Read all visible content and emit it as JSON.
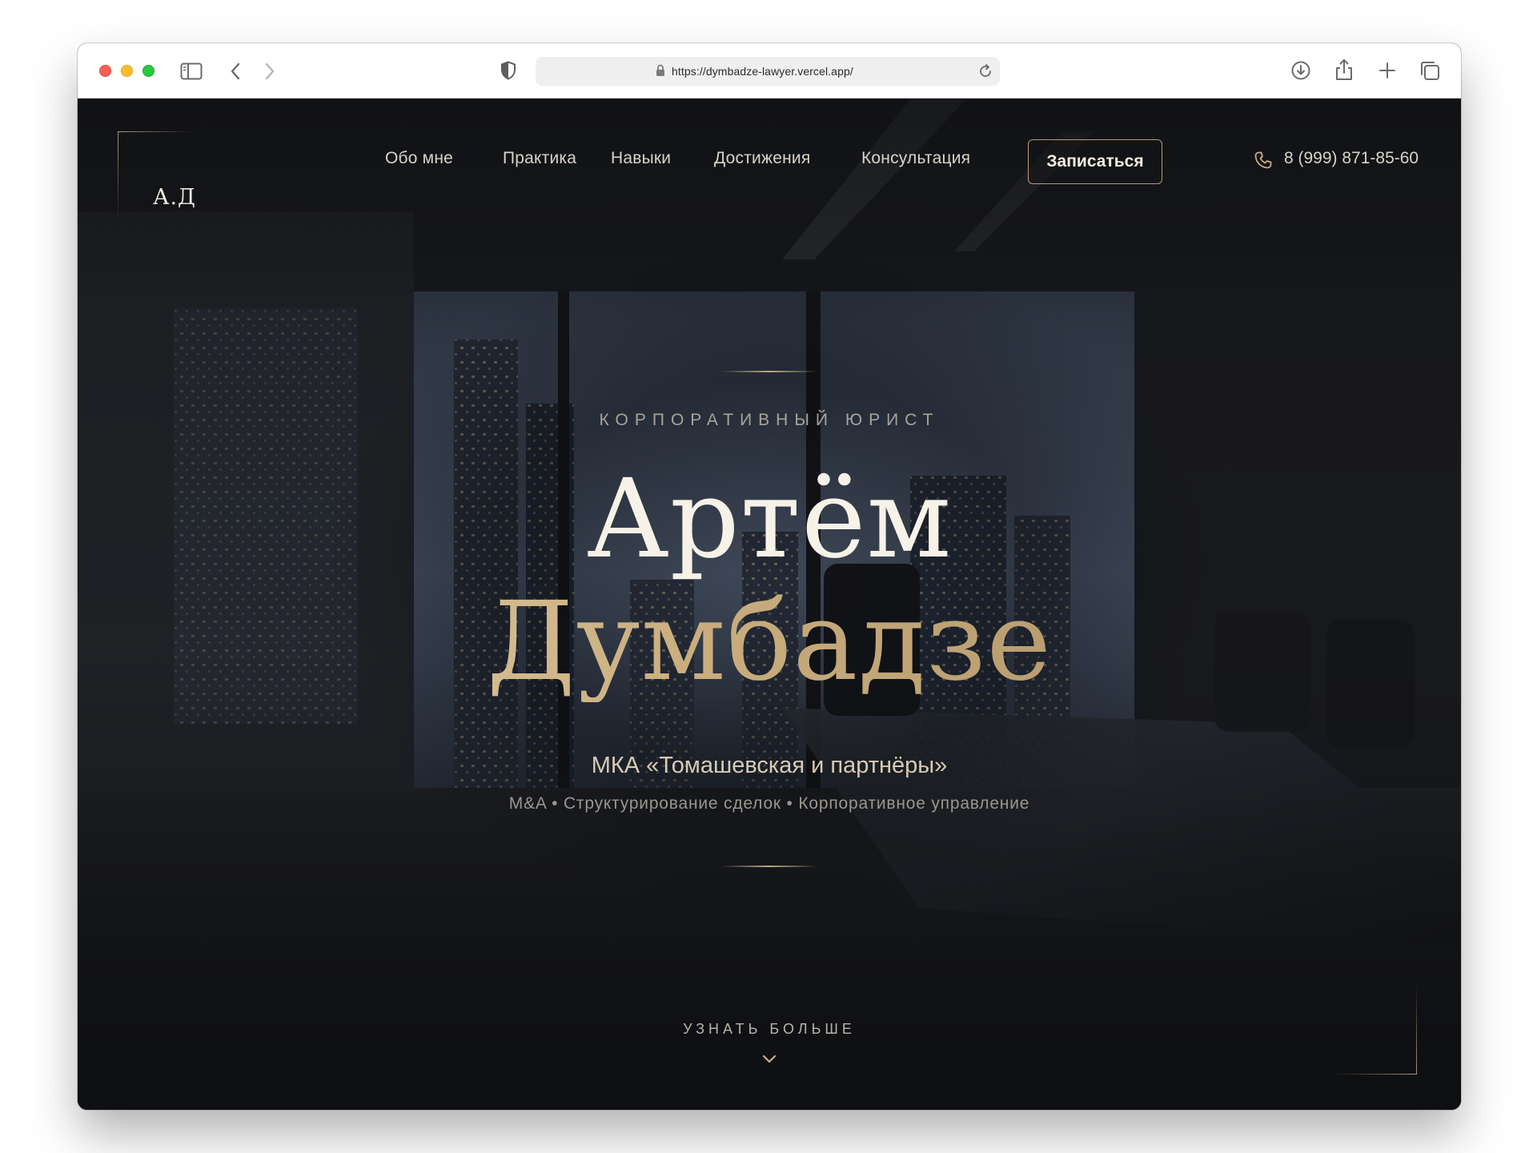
{
  "browser": {
    "url": "https://dymbadze-lawyer.vercel.app/"
  },
  "site": {
    "logo": "А.Д",
    "nav": {
      "items": [
        "Обо мне",
        "Практика",
        "Навыки",
        "Достижения",
        "Консультация"
      ],
      "cta": "Записаться",
      "phone": "8 (999) 871-85-60"
    },
    "hero": {
      "eyebrow": "КОРПОРАТИВНЫЙ ЮРИСТ",
      "first_name": "Артём",
      "last_name": "Думбадзе",
      "firm": "МКА «Томашевская и партнёры»",
      "specialties": "M&A • Структурирование сделок • Корпоративное управление",
      "learn_more": "УЗНАТЬ БОЛЬШЕ"
    }
  },
  "colors": {
    "accent_gold": "#c9b083",
    "background_dark": "#16171a",
    "text_light": "#f2ece1"
  },
  "icons": {
    "sidebar": "sidebar-icon",
    "back": "chevron-left-icon",
    "forward": "chevron-right-icon",
    "privacy": "shield-icon",
    "lock": "lock-icon",
    "reload": "reload-icon",
    "download": "download-icon",
    "share": "share-icon",
    "new_tab": "plus-icon",
    "tabs": "tabs-icon",
    "phone": "phone-icon",
    "scroll": "chevron-down-icon"
  }
}
